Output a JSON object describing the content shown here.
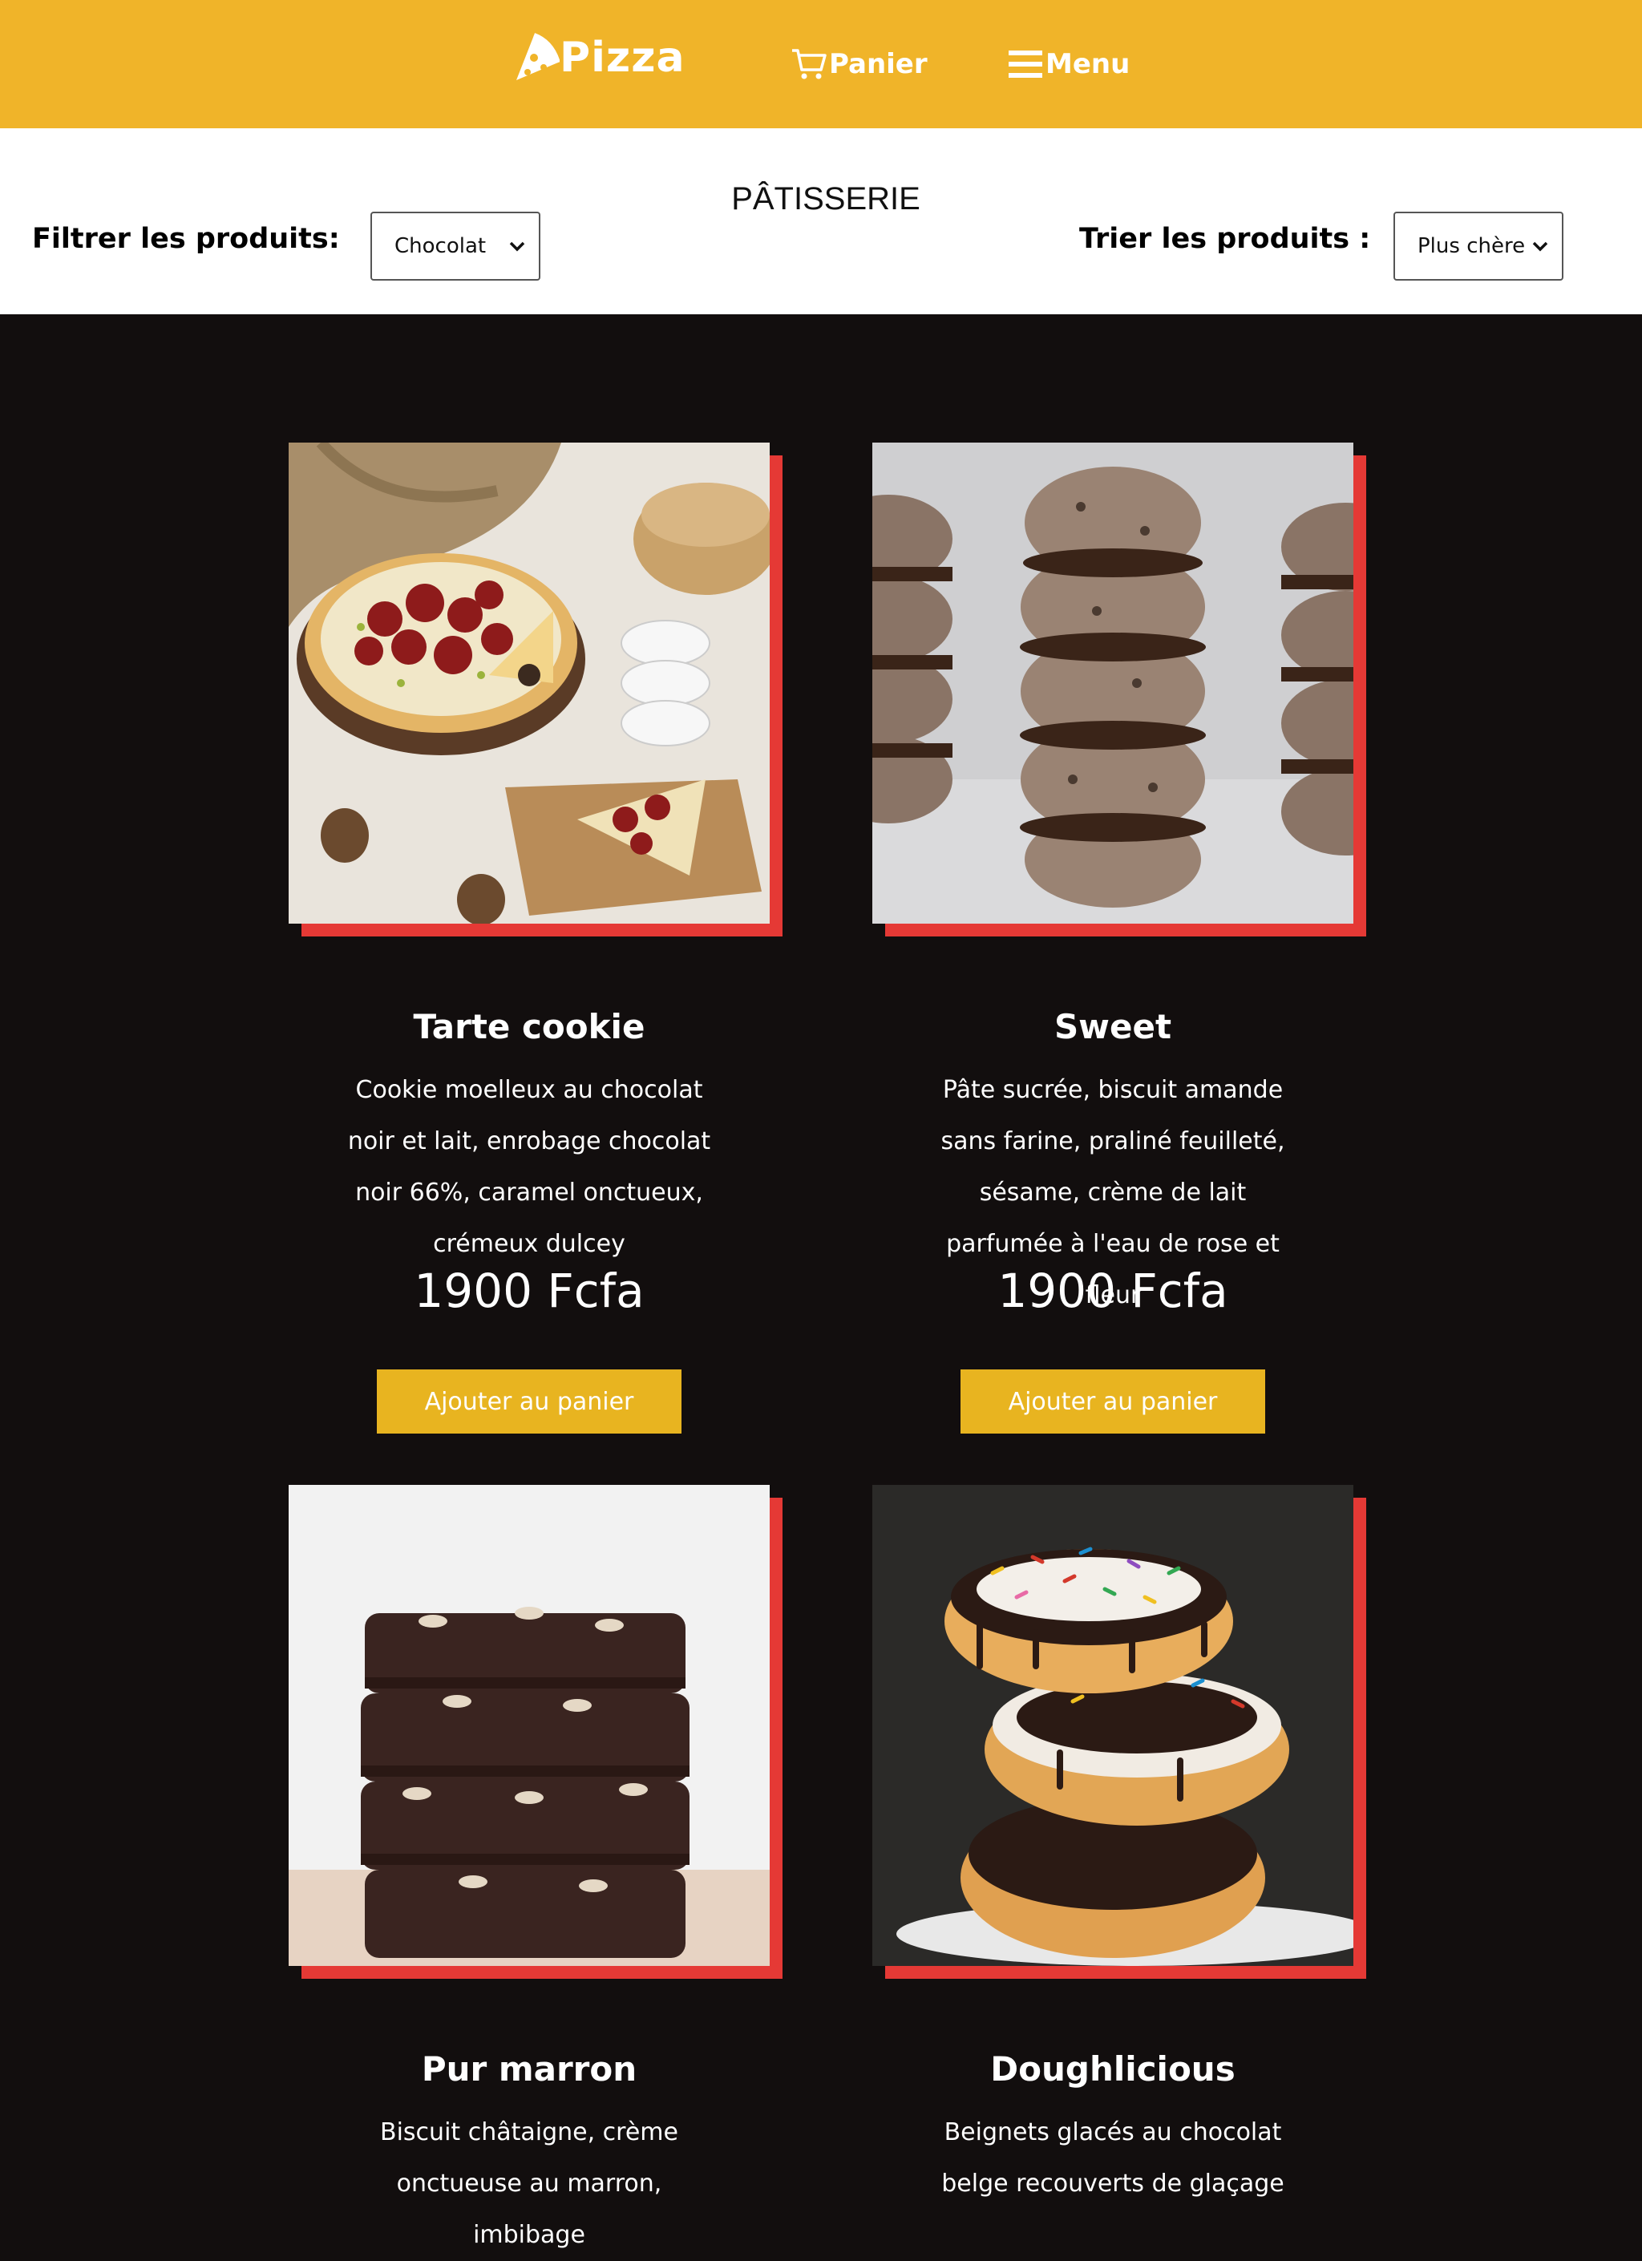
{
  "header": {
    "brand": "Pizza",
    "cart_label": "Panier",
    "menu_label": "Menu"
  },
  "filters": {
    "section_title": "PÂTISSERIE",
    "filter_label": "Filtrer les produits:",
    "filter_value": "Chocolat",
    "sort_label": "Trier les produits :",
    "sort_value": "Plus chère"
  },
  "colors": {
    "header_bg": "#f0b429",
    "page_bg": "#120e0e",
    "accent_red": "#e53935",
    "button_yellow": "#e8b420"
  },
  "products": [
    {
      "name": "Tarte cookie",
      "desc": "Cookie moelleux au chocolat noir et lait, enrobage chocolat noir 66%, caramel onctueux, crémeux dulcey",
      "price": "1900 Fcfa",
      "button": "Ajouter au panier",
      "image": "tart-photo"
    },
    {
      "name": "Sweet",
      "desc": "Pâte sucrée, biscuit amande sans farine, praliné feuilleté, sésame, crème de lait parfumée à l'eau de rose et fleur",
      "price": "1900 Fcfa",
      "button": "Ajouter au panier",
      "image": "cookie-sandwich-photo"
    },
    {
      "name": "Pur marron",
      "desc": "Biscuit châtaigne, crème onctueuse au marron, imbibage",
      "image": "brownie-stack-photo"
    },
    {
      "name": "Doughlicious",
      "desc": "Beignets glacés au chocolat belge recouverts de glaçage",
      "image": "donut-stack-photo"
    }
  ]
}
